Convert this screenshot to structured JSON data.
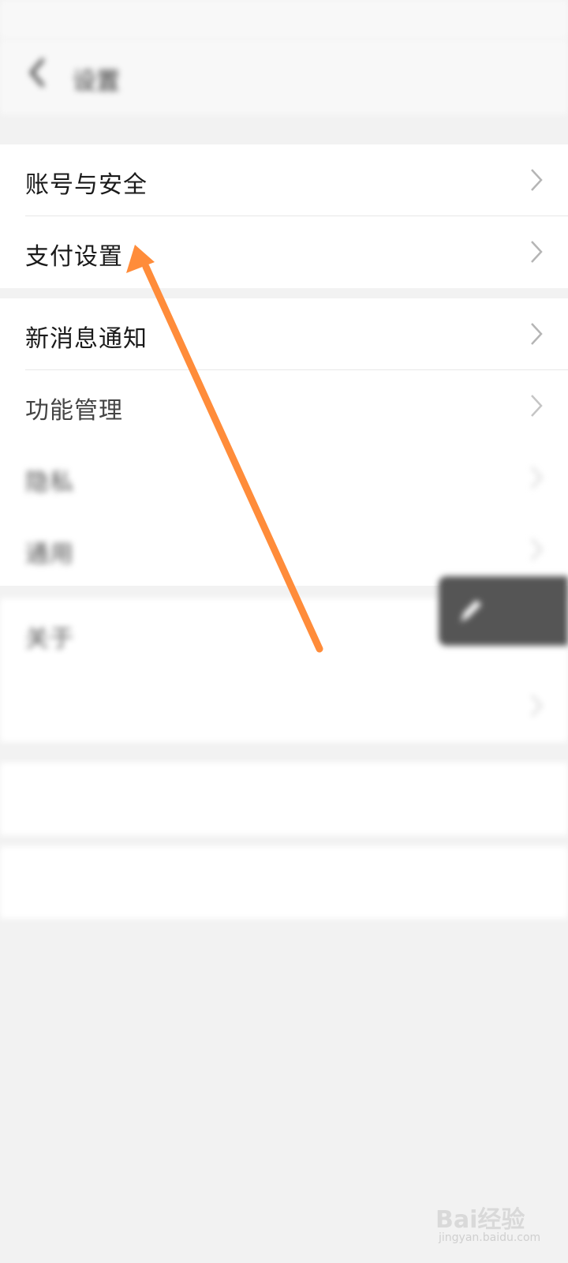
{
  "status_bar": {
    "left_text": "",
    "right_text": ""
  },
  "header": {
    "title": "设置"
  },
  "group1": [
    {
      "label": "账号与安全",
      "value": ""
    },
    {
      "label": "支付设置",
      "value": ""
    }
  ],
  "group2": [
    {
      "label": "新消息通知",
      "value": ""
    },
    {
      "label": "功能管理",
      "value": ""
    },
    {
      "label": "隐私",
      "value": ""
    },
    {
      "label": "通用",
      "value": ""
    }
  ],
  "group3": [
    {
      "label": "关于",
      "value": ""
    },
    {
      "label": "",
      "value": ""
    }
  ],
  "actions": {
    "switch_account": "",
    "logout": ""
  },
  "floating_button": {
    "line1": "",
    "line2": ""
  },
  "annotation": {
    "arrow_color": "#ff8c3a"
  },
  "watermark": {
    "brand": "Bai经验",
    "url": "jingyan.baidu.com"
  }
}
